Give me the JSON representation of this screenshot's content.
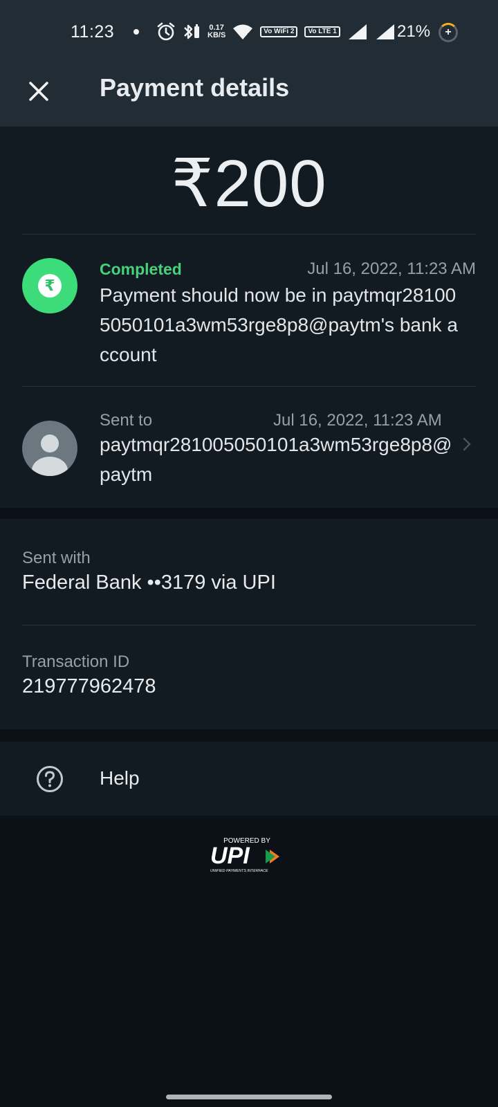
{
  "status_bar": {
    "time": "11:23",
    "net_speed_value": "0.17",
    "net_speed_unit": "KB/S",
    "wifi_badge": "Vo WiFi 2",
    "lte_badge": "Vo LTE 1",
    "battery": "21%"
  },
  "header": {
    "title": "Payment details",
    "close_icon": "close-icon"
  },
  "payment": {
    "amount": "₹200",
    "status": {
      "label": "Completed",
      "date": "Jul 16, 2022, 11:23 AM",
      "message": "Payment should now be in paytmqr281005050101a3wm53rge8p8@paytm's bank account",
      "color": "#46d17b"
    },
    "recipient": {
      "label": "Sent to",
      "date": "Jul 16, 2022, 11:23 AM",
      "value": "paytmqr281005050101a3wm53rge8p8@paytm"
    }
  },
  "details": {
    "sent_with_label": "Sent with",
    "sent_with_value": "Federal Bank ••3179 via UPI",
    "txn_label": "Transaction ID",
    "txn_value": "219777962478"
  },
  "help": {
    "label": "Help",
    "icon": "help-circle-icon"
  },
  "footer": {
    "powered_by": "POWERED BY",
    "brand": "UPI",
    "brand_subtitle": "UNIFIED PAYMENTS INTERFACE"
  }
}
